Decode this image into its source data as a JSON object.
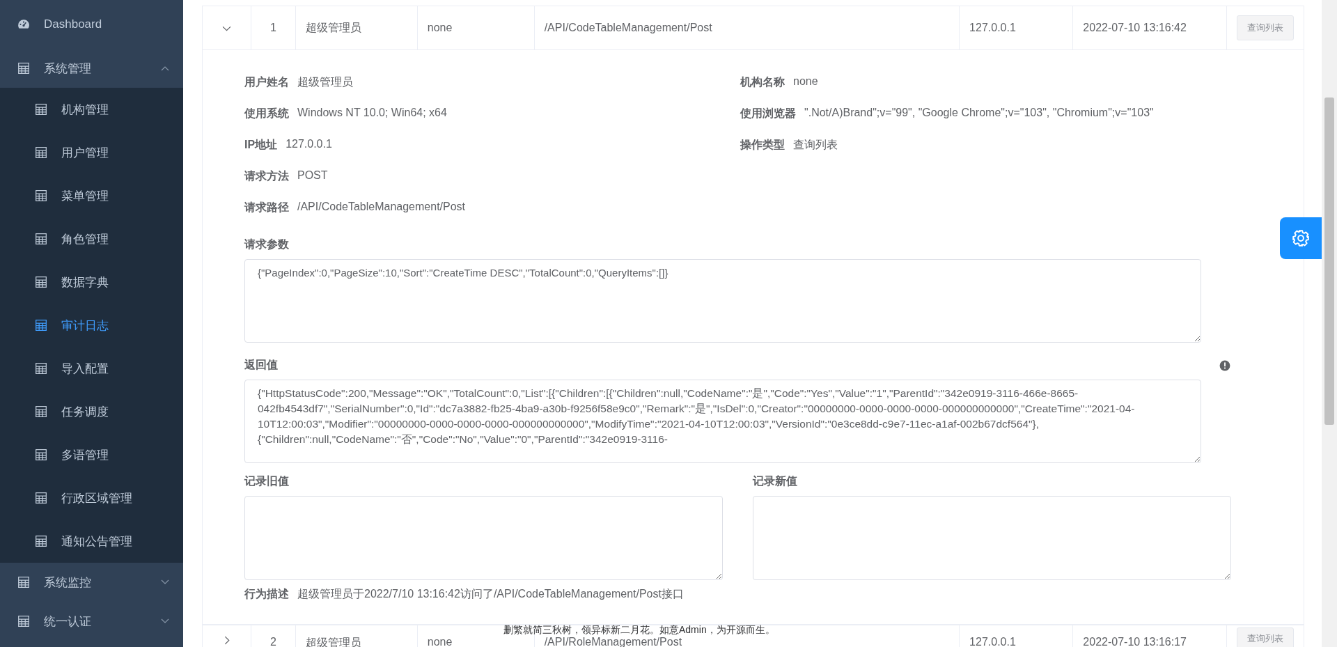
{
  "sidebar": {
    "items": [
      {
        "kind": "link",
        "label": "Dashboard",
        "selected": false
      },
      {
        "kind": "group",
        "label": "系统管理",
        "expanded": true,
        "children": [
          {
            "label": "机构管理",
            "selected": false
          },
          {
            "label": "用户管理",
            "selected": false
          },
          {
            "label": "菜单管理",
            "selected": false
          },
          {
            "label": "角色管理",
            "selected": false
          },
          {
            "label": "数据字典",
            "selected": false
          },
          {
            "label": "审计日志",
            "selected": true
          },
          {
            "label": "导入配置",
            "selected": false
          },
          {
            "label": "任务调度",
            "selected": false
          },
          {
            "label": "多语管理",
            "selected": false
          },
          {
            "label": "行政区域管理",
            "selected": false
          },
          {
            "label": "通知公告管理",
            "selected": false
          }
        ]
      },
      {
        "kind": "group",
        "label": "系统监控",
        "expanded": false
      },
      {
        "kind": "group",
        "label": "统一认证",
        "expanded": false
      }
    ]
  },
  "table": {
    "rows": [
      {
        "expanded": true,
        "cells": [
          "1",
          "超级管理员",
          "none",
          "/API/CodeTableManagement/Post",
          "127.0.0.1",
          "2022-07-10 13:16:42"
        ],
        "action": "查询列表",
        "detail": {
          "info_rows": [
            [
              {
                "label": "用户姓名",
                "value": "超级管理员"
              },
              {
                "label": "机构名称",
                "value": "none"
              }
            ],
            [
              {
                "label": "使用系统",
                "value": "Windows NT 10.0; Win64; x64"
              },
              {
                "label": "使用浏览器",
                "value": "\".Not/A)Brand\";v=\"99\", \"Google Chrome\";v=\"103\", \"Chromium\";v=\"103\""
              }
            ],
            [
              {
                "label": "IP地址",
                "value": "127.0.0.1"
              },
              {
                "label": "操作类型",
                "value": "查询列表"
              }
            ],
            [
              {
                "label": "请求方法",
                "value": "POST"
              }
            ],
            [
              {
                "label": "请求路径",
                "value": "/API/CodeTableManagement/Post"
              }
            ]
          ],
          "request_params": {
            "label": "请求参数",
            "value": "{\"PageIndex\":0,\"PageSize\":10,\"Sort\":\"CreateTime DESC\",\"TotalCount\":0,\"QueryItems\":[]}"
          },
          "response": {
            "label": "返回值",
            "value": "{\"HttpStatusCode\":200,\"Message\":\"OK\",\"TotalCount\":0,\"List\":[{\"Children\":[{\"Children\":null,\"CodeName\":\"是\",\"Code\":\"Yes\",\"Value\":\"1\",\"ParentId\":\"342e0919-3116-466e-8665-042fb4543df7\",\"SerialNumber\":0,\"Id\":\"dc7a3882-fb25-4ba9-a30b-f9256f58e9c0\",\"Remark\":\"是\",\"IsDel\":0,\"Creator\":\"00000000-0000-0000-0000-000000000000\",\"CreateTime\":\"2021-04-10T12:00:03\",\"Modifier\":\"00000000-0000-0000-0000-000000000000\",\"ModifyTime\":\"2021-04-10T12:00:03\",\"VersionId\":\"0e3ce8dd-c9e7-11ec-a1af-002b67dcf564\"},{\"Children\":null,\"CodeName\":\"否\",\"Code\":\"No\",\"Value\":\"0\",\"ParentId\":\"342e0919-3116-"
          },
          "old_value": {
            "label": "记录旧值"
          },
          "new_value": {
            "label": "记录新值"
          },
          "behavior": {
            "label": "行为描述",
            "value": "超级管理员于2022/7/10 13:16:42访问了/API/CodeTableManagement/Post接口"
          }
        }
      },
      {
        "expanded": false,
        "cells": [
          "2",
          "超级管理员",
          "none",
          "/API/RoleManagement/Post",
          "127.0.0.1",
          "2022-07-10 13:16:17"
        ],
        "action": "查询列表"
      }
    ]
  },
  "footer": "删繁就简三秋树，领异标新二月花。如意Admin，为开源而生。"
}
